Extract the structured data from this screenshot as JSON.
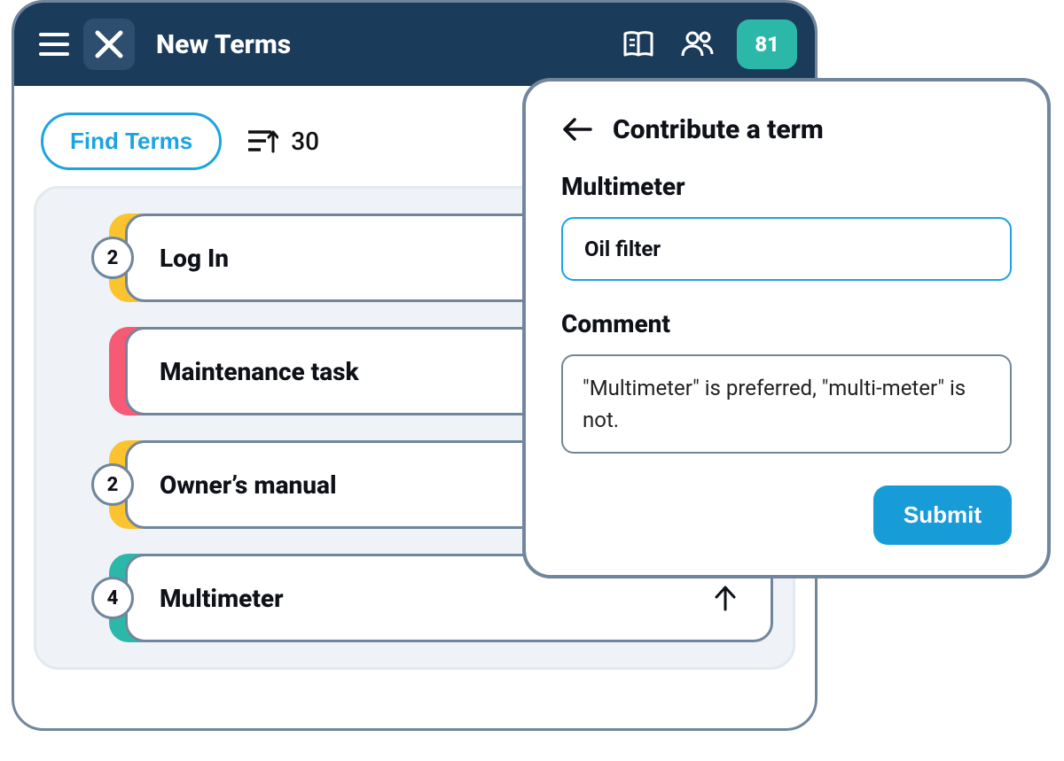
{
  "header": {
    "title": "New Terms",
    "badge_count": "81"
  },
  "toolbar": {
    "find_terms_label": "Find Terms",
    "sort_count": "30"
  },
  "terms": [
    {
      "count": "2",
      "label": "Log In",
      "color": "#fbc42f",
      "has_count": true,
      "has_arrow": false
    },
    {
      "count": "",
      "label": "Maintenance task",
      "color": "#f65a74",
      "has_count": false,
      "has_arrow": false
    },
    {
      "count": "2",
      "label": "Owner’s manual",
      "color": "#fbc42f",
      "has_count": true,
      "has_arrow": false
    },
    {
      "count": "4",
      "label": "Multimeter",
      "color": "#2cb8a9",
      "has_count": true,
      "has_arrow": true
    }
  ],
  "modal": {
    "title": "Contribute a term",
    "term_label": "Multimeter",
    "term_value": "Oil filter",
    "comment_label": "Comment",
    "comment_value": "\"Multimeter\" is preferred, \"multi-meter\" is not.",
    "submit_label": "Submit"
  }
}
